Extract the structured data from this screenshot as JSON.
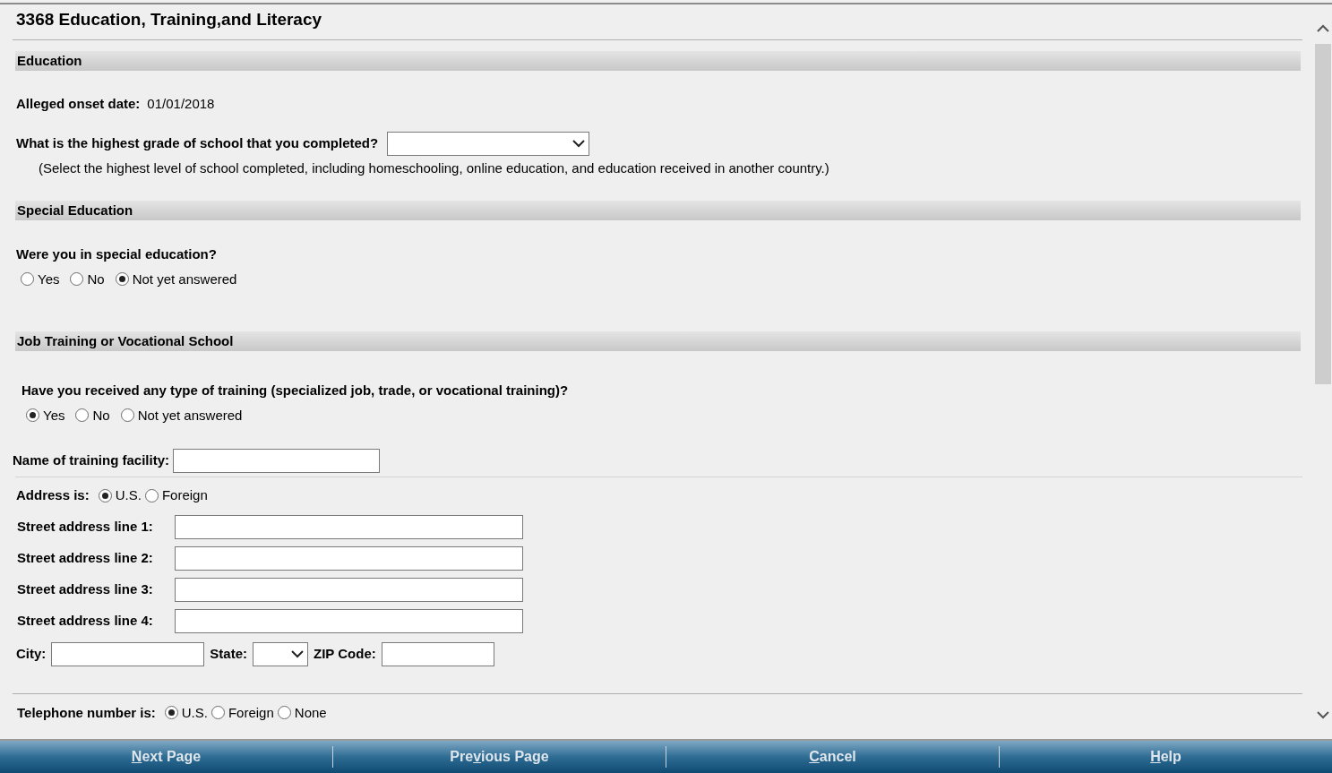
{
  "page": {
    "title": "3368 Education, Training,and Literacy"
  },
  "education": {
    "heading": "Education",
    "onset_label": "Alleged onset date:",
    "onset_value": "01/01/2018",
    "grade_question": "What is the highest grade of school that you completed?",
    "grade_hint": "(Select the highest level of school completed, including homeschooling, online education, and education received in another country.)"
  },
  "special_education": {
    "heading": "Special Education",
    "question": "Were you in special education?",
    "options": [
      {
        "label": "Yes",
        "selected": false
      },
      {
        "label": "No",
        "selected": false
      },
      {
        "label": "Not yet answered",
        "selected": true
      }
    ]
  },
  "job_training": {
    "heading": "Job Training or Vocational School",
    "question": "Have you received any type of training (specialized job, trade, or vocational training)?",
    "options": [
      {
        "label": "Yes",
        "selected": true
      },
      {
        "label": "No",
        "selected": false
      },
      {
        "label": "Not yet answered",
        "selected": false
      }
    ],
    "facility_label": "Name of training facility:",
    "address_type": {
      "label": "Address is:",
      "options": [
        {
          "label": "U.S.",
          "selected": true
        },
        {
          "label": "Foreign",
          "selected": false
        }
      ]
    },
    "street_lines": [
      "Street address line 1:",
      "Street address line 2:",
      "Street address line 3:",
      "Street address line 4:"
    ],
    "city_label": "City:",
    "state_label": "State:",
    "zip_label": "ZIP Code:",
    "phone_type": {
      "label": "Telephone number is:",
      "options": [
        {
          "label": "U.S.",
          "selected": true
        },
        {
          "label": "Foreign",
          "selected": false
        },
        {
          "label": "None",
          "selected": false
        }
      ]
    }
  },
  "footer": {
    "buttons": [
      {
        "key": "N",
        "post": "ext Page"
      },
      {
        "pre": "Pre",
        "key": "v",
        "post": "ious Page"
      },
      {
        "key": "C",
        "post": "ancel"
      },
      {
        "key": "H",
        "post": "elp"
      }
    ]
  }
}
